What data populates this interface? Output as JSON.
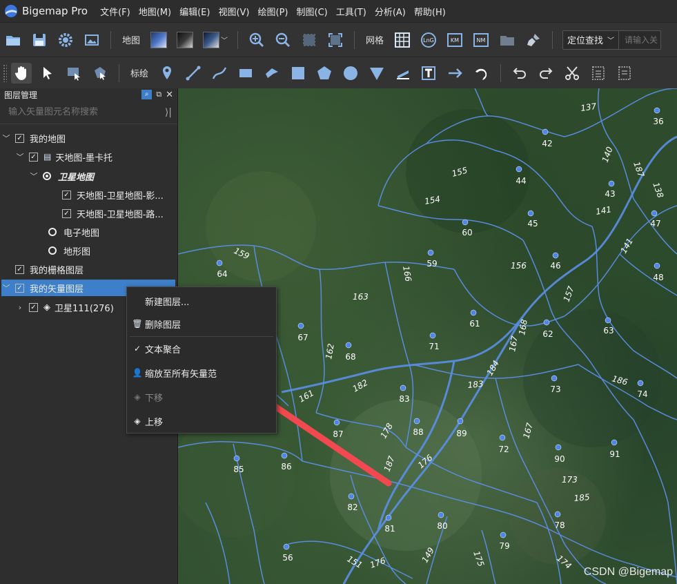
{
  "app": {
    "title": "Bigemap Pro"
  },
  "menu": [
    "文件(F)",
    "地图(M)",
    "编辑(E)",
    "视图(V)",
    "绘图(P)",
    "制图(C)",
    "工具(T)",
    "分析(A)",
    "帮助(H)"
  ],
  "toolbar1": {
    "map_label": "地图",
    "grid_label": "网格",
    "grid_icons": [
      "LnG",
      "KM",
      "NM"
    ],
    "locate_label": "定位查找",
    "locate_placeholder": "请输入关"
  },
  "toolbar2": {
    "annotate_label": "标绘"
  },
  "layer_panel": {
    "title": "图层管理",
    "search_placeholder": "输入矢量图元名称搜索",
    "items": [
      {
        "label": "我的地图"
      },
      {
        "label": "天地图-墨卡托"
      },
      {
        "label": "卫星地图"
      },
      {
        "label": "天地图-卫星地图-影..."
      },
      {
        "label": "天地图-卫星地图-路..."
      },
      {
        "label": "电子地图"
      },
      {
        "label": "地形图"
      },
      {
        "label": "我的栅格图层"
      },
      {
        "label": "我的矢量图层"
      },
      {
        "label": "卫星111(276)"
      }
    ]
  },
  "context_menu": {
    "items": [
      {
        "label": "新建图层..."
      },
      {
        "label": "删除图层"
      },
      {
        "label": "文本聚合",
        "checked": true
      },
      {
        "label": "缩放至所有矢量范"
      },
      {
        "label": "下移",
        "disabled": true
      },
      {
        "label": "上移"
      }
    ]
  },
  "map": {
    "watermark": "CSDN @Bigemap",
    "point_labels": [
      "36",
      "42",
      "44",
      "43",
      "47",
      "45",
      "60",
      "59",
      "46",
      "48",
      "64",
      "67",
      "68",
      "61",
      "71",
      "62",
      "63",
      "74",
      "73",
      "83",
      "87",
      "88",
      "89",
      "72",
      "90",
      "91",
      "85",
      "86",
      "82",
      "81",
      "80",
      "78",
      "79",
      "56"
    ],
    "line_labels": [
      "137",
      "140",
      "187",
      "138",
      "155",
      "154",
      "141",
      "141",
      "159",
      "156",
      "166",
      "157",
      "163",
      "168",
      "167",
      "162",
      "184",
      "183",
      "186",
      "161",
      "182",
      "178",
      "167",
      "187",
      "176",
      "173",
      "185",
      "151",
      "176",
      "149",
      "175",
      "174"
    ]
  },
  "colors": {
    "accent": "#3d7fc8",
    "boundary": "#5b8fe6",
    "point": "#4f86e8",
    "arrow": "#f2484f"
  }
}
